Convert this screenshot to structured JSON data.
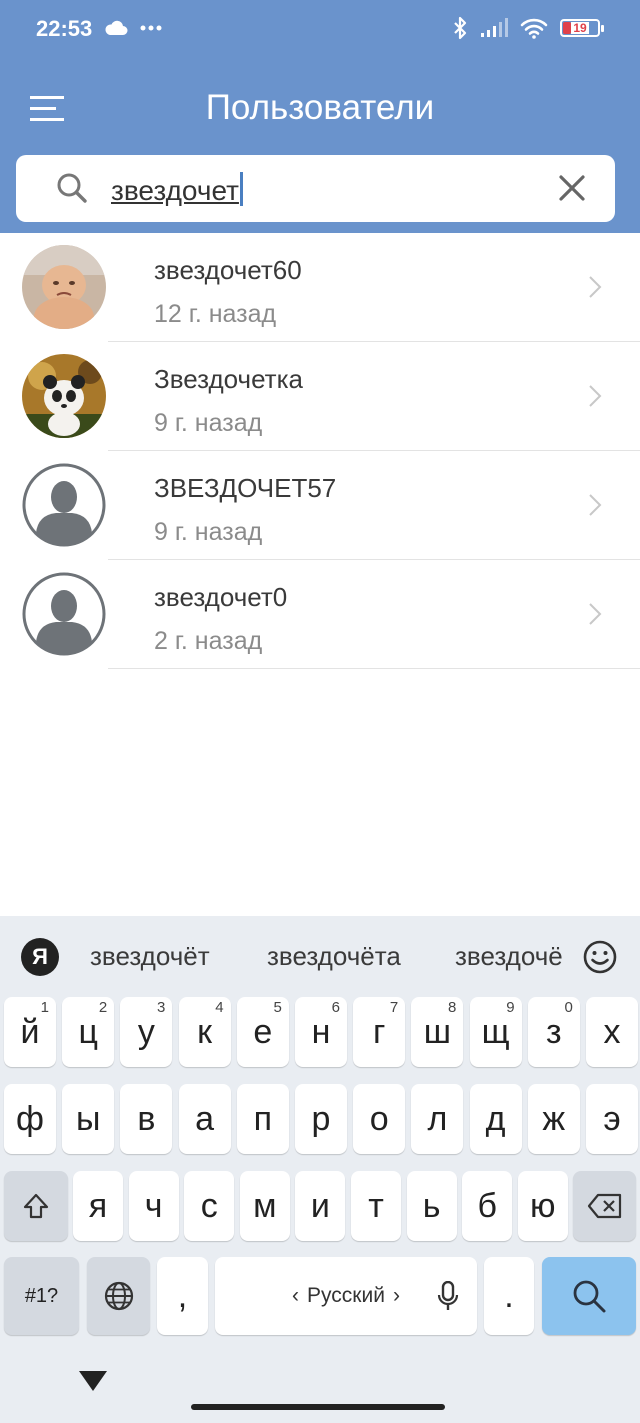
{
  "status_bar": {
    "time": "22:53",
    "icons_left": [
      "cloud-icon",
      "more-dots-icon"
    ],
    "icons_right": [
      "bluetooth-icon",
      "signal-icon",
      "wifi-icon",
      "battery-icon"
    ],
    "battery_level": "19",
    "battery_color": "#e0414a"
  },
  "header": {
    "title": "Пользователи",
    "background": "#6a93cc"
  },
  "search": {
    "value": "звездочет",
    "icon": "search-icon",
    "clear_icon": "close-icon"
  },
  "users": [
    {
      "name": "звездочет60",
      "time": "12 г. назад",
      "avatar": "photo-baby"
    },
    {
      "name": "Звездочетка",
      "time": "9 г. назад",
      "avatar": "photo-panda"
    },
    {
      "name": "ЗВЕЗДОЧЕТ57",
      "time": "9 г. назад",
      "avatar": "default-avatar"
    },
    {
      "name": "звездочет0",
      "time": "2 г. назад",
      "avatar": "default-avatar"
    }
  ],
  "keyboard": {
    "logo": "Я",
    "suggestions": [
      "звездочёт",
      "звездочёта",
      "звездочё"
    ],
    "row1": [
      {
        "k": "й",
        "h": "1"
      },
      {
        "k": "ц",
        "h": "2"
      },
      {
        "k": "у",
        "h": "3"
      },
      {
        "k": "к",
        "h": "4"
      },
      {
        "k": "е",
        "h": "5"
      },
      {
        "k": "н",
        "h": "6"
      },
      {
        "k": "г",
        "h": "7"
      },
      {
        "k": "ш",
        "h": "8"
      },
      {
        "k": "щ",
        "h": "9"
      },
      {
        "k": "з",
        "h": "0"
      },
      {
        "k": "х",
        "h": ""
      }
    ],
    "row2": [
      "ф",
      "ы",
      "в",
      "а",
      "п",
      "р",
      "о",
      "л",
      "д",
      "ж",
      "э"
    ],
    "row3": [
      "я",
      "ч",
      "с",
      "м",
      "и",
      "т",
      "ь",
      "б",
      "ю"
    ],
    "symbols_label": "#1?",
    "comma": ",",
    "space_label": "Русский",
    "period": ".",
    "accent_color": "#8cc3ee"
  }
}
